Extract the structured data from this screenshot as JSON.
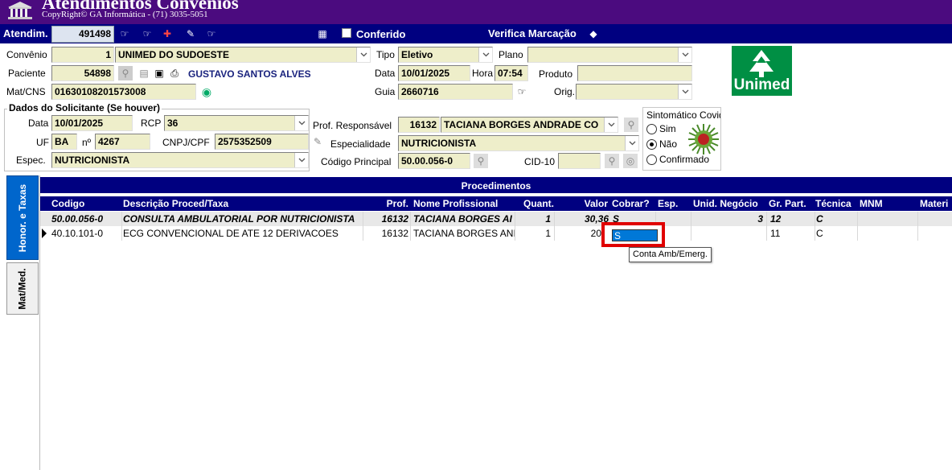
{
  "window": {
    "title": "Atendimentos Convênios",
    "copyright": "CopyRight© GA Informática - (71) 3035-5051"
  },
  "navbar": {
    "atendim_label": "Atendim.",
    "atendim_value": "491498",
    "conferido_label": "Conferido",
    "conferido_checked": false,
    "verifica_label": "Verifica Marcação"
  },
  "form": {
    "convenio": {
      "label": "Convênio",
      "code": "1",
      "name": "UNIMED DO SUDOESTE"
    },
    "tipo": {
      "label": "Tipo",
      "value": "Eletivo"
    },
    "plano": {
      "label": "Plano",
      "value": ""
    },
    "paciente": {
      "label": "Paciente",
      "code": "54898",
      "name": "GUSTAVO SANTOS ALVES"
    },
    "data": {
      "label": "Data",
      "value": "10/01/2025"
    },
    "hora": {
      "label": "Hora",
      "value": "07:54"
    },
    "produto": {
      "label": "Produto",
      "value": ""
    },
    "mat_cns": {
      "label": "Mat/CNS",
      "value": "01630108201573008"
    },
    "guia": {
      "label": "Guia",
      "value": "2660716"
    },
    "orig": {
      "label": "Orig.",
      "value": ""
    }
  },
  "solicitante": {
    "group_title": "Dados do Solicitante (Se houver)",
    "data_label": "Data",
    "data_value": "10/01/2025",
    "rcp_label": "RCP",
    "rcp_value": "36",
    "uf_label": "UF",
    "uf_value": "BA",
    "no_label": "nº",
    "no_value": "4267",
    "cnpj_label": "CNPJ/CPF",
    "cnpj_value": "2575352509",
    "espec_label": "Espec.",
    "espec_value": "NUTRICIONISTA"
  },
  "profissional": {
    "prof_label": "Prof. Responsável",
    "prof_code": "16132",
    "prof_name": "TACIANA BORGES ANDRADE CO",
    "especialidade_label": "Especialidade",
    "especialidade_value": "NUTRICIONISTA",
    "codigo_label": "Código Principal",
    "codigo_value": "50.00.056-0",
    "cid_label": "CID-10",
    "cid_value": ""
  },
  "sintomatico": {
    "title": "Sintomático Covid",
    "options": [
      "Sim",
      "Não",
      "Confirmado"
    ],
    "selected": "Não"
  },
  "logo": {
    "text": "Unimed",
    "color": "#008f44"
  },
  "tabs": [
    {
      "label": "Honor. e Taxas",
      "active": true
    },
    {
      "label": "Mat/Med.",
      "active": false
    }
  ],
  "procedures": {
    "title": "Procedimentos",
    "columns": [
      "Codigo",
      "Descrição Proced/Taxa",
      "Prof.",
      "Nome Profissional",
      "Quant.",
      "Valor",
      "Cobrar?",
      "Esp.",
      "Unid. Negócio",
      "Gr. Part.",
      "Técnica",
      "MNM",
      "Materi"
    ],
    "rows": [
      {
        "codigo": "50.00.056-0",
        "descricao": "CONSULTA AMBULATORIAL POR NUTRICIONISTA",
        "prof": "16132",
        "nome": "TACIANA BORGES AI",
        "quant": "1",
        "valor": "30,36",
        "cobrar": "S",
        "esp": "",
        "unid": "3",
        "grpart": "12",
        "tecnica": "C",
        "mnm": "",
        "materi": ""
      },
      {
        "codigo": "40.10.101-0",
        "descricao": "ECG CONVENCIONAL DE ATE 12 DERIVACOES",
        "prof": "16132",
        "nome": "TACIANA BORGES ANI",
        "quant": "1",
        "valor": "20,0",
        "cobrar": "S",
        "esp": "",
        "unid": "",
        "grpart": "11",
        "tecnica": "C",
        "mnm": "",
        "materi": ""
      }
    ],
    "tooltip": "Conta Amb/Emerg.",
    "highlight_color": "#e00000",
    "selection_color": "#0078d7"
  }
}
